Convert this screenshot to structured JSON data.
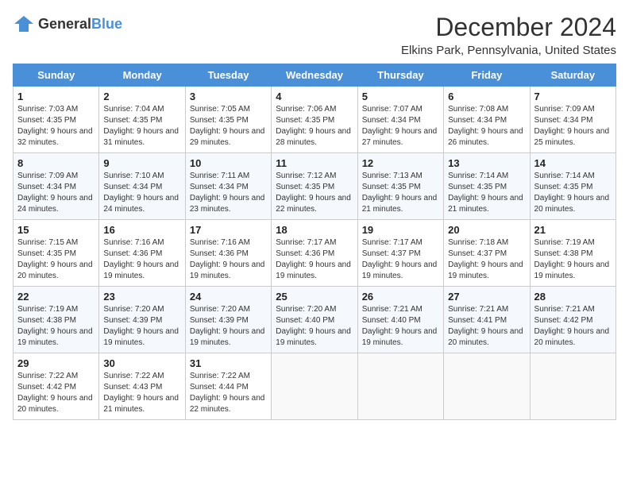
{
  "logo": {
    "text_general": "General",
    "text_blue": "Blue"
  },
  "header": {
    "month": "December 2024",
    "location": "Elkins Park, Pennsylvania, United States"
  },
  "weekdays": [
    "Sunday",
    "Monday",
    "Tuesday",
    "Wednesday",
    "Thursday",
    "Friday",
    "Saturday"
  ],
  "weeks": [
    [
      {
        "day": "1",
        "sunrise": "7:03 AM",
        "sunset": "4:35 PM",
        "daylight": "9 hours and 32 minutes."
      },
      {
        "day": "2",
        "sunrise": "7:04 AM",
        "sunset": "4:35 PM",
        "daylight": "9 hours and 31 minutes."
      },
      {
        "day": "3",
        "sunrise": "7:05 AM",
        "sunset": "4:35 PM",
        "daylight": "9 hours and 29 minutes."
      },
      {
        "day": "4",
        "sunrise": "7:06 AM",
        "sunset": "4:35 PM",
        "daylight": "9 hours and 28 minutes."
      },
      {
        "day": "5",
        "sunrise": "7:07 AM",
        "sunset": "4:34 PM",
        "daylight": "9 hours and 27 minutes."
      },
      {
        "day": "6",
        "sunrise": "7:08 AM",
        "sunset": "4:34 PM",
        "daylight": "9 hours and 26 minutes."
      },
      {
        "day": "7",
        "sunrise": "7:09 AM",
        "sunset": "4:34 PM",
        "daylight": "9 hours and 25 minutes."
      }
    ],
    [
      {
        "day": "8",
        "sunrise": "7:09 AM",
        "sunset": "4:34 PM",
        "daylight": "9 hours and 24 minutes."
      },
      {
        "day": "9",
        "sunrise": "7:10 AM",
        "sunset": "4:34 PM",
        "daylight": "9 hours and 24 minutes."
      },
      {
        "day": "10",
        "sunrise": "7:11 AM",
        "sunset": "4:34 PM",
        "daylight": "9 hours and 23 minutes."
      },
      {
        "day": "11",
        "sunrise": "7:12 AM",
        "sunset": "4:35 PM",
        "daylight": "9 hours and 22 minutes."
      },
      {
        "day": "12",
        "sunrise": "7:13 AM",
        "sunset": "4:35 PM",
        "daylight": "9 hours and 21 minutes."
      },
      {
        "day": "13",
        "sunrise": "7:14 AM",
        "sunset": "4:35 PM",
        "daylight": "9 hours and 21 minutes."
      },
      {
        "day": "14",
        "sunrise": "7:14 AM",
        "sunset": "4:35 PM",
        "daylight": "9 hours and 20 minutes."
      }
    ],
    [
      {
        "day": "15",
        "sunrise": "7:15 AM",
        "sunset": "4:35 PM",
        "daylight": "9 hours and 20 minutes."
      },
      {
        "day": "16",
        "sunrise": "7:16 AM",
        "sunset": "4:36 PM",
        "daylight": "9 hours and 19 minutes."
      },
      {
        "day": "17",
        "sunrise": "7:16 AM",
        "sunset": "4:36 PM",
        "daylight": "9 hours and 19 minutes."
      },
      {
        "day": "18",
        "sunrise": "7:17 AM",
        "sunset": "4:36 PM",
        "daylight": "9 hours and 19 minutes."
      },
      {
        "day": "19",
        "sunrise": "7:17 AM",
        "sunset": "4:37 PM",
        "daylight": "9 hours and 19 minutes."
      },
      {
        "day": "20",
        "sunrise": "7:18 AM",
        "sunset": "4:37 PM",
        "daylight": "9 hours and 19 minutes."
      },
      {
        "day": "21",
        "sunrise": "7:19 AM",
        "sunset": "4:38 PM",
        "daylight": "9 hours and 19 minutes."
      }
    ],
    [
      {
        "day": "22",
        "sunrise": "7:19 AM",
        "sunset": "4:38 PM",
        "daylight": "9 hours and 19 minutes."
      },
      {
        "day": "23",
        "sunrise": "7:20 AM",
        "sunset": "4:39 PM",
        "daylight": "9 hours and 19 minutes."
      },
      {
        "day": "24",
        "sunrise": "7:20 AM",
        "sunset": "4:39 PM",
        "daylight": "9 hours and 19 minutes."
      },
      {
        "day": "25",
        "sunrise": "7:20 AM",
        "sunset": "4:40 PM",
        "daylight": "9 hours and 19 minutes."
      },
      {
        "day": "26",
        "sunrise": "7:21 AM",
        "sunset": "4:40 PM",
        "daylight": "9 hours and 19 minutes."
      },
      {
        "day": "27",
        "sunrise": "7:21 AM",
        "sunset": "4:41 PM",
        "daylight": "9 hours and 20 minutes."
      },
      {
        "day": "28",
        "sunrise": "7:21 AM",
        "sunset": "4:42 PM",
        "daylight": "9 hours and 20 minutes."
      }
    ],
    [
      {
        "day": "29",
        "sunrise": "7:22 AM",
        "sunset": "4:42 PM",
        "daylight": "9 hours and 20 minutes."
      },
      {
        "day": "30",
        "sunrise": "7:22 AM",
        "sunset": "4:43 PM",
        "daylight": "9 hours and 21 minutes."
      },
      {
        "day": "31",
        "sunrise": "7:22 AM",
        "sunset": "4:44 PM",
        "daylight": "9 hours and 22 minutes."
      },
      null,
      null,
      null,
      null
    ]
  ],
  "labels": {
    "sunrise": "Sunrise:",
    "sunset": "Sunset:",
    "daylight": "Daylight:"
  }
}
